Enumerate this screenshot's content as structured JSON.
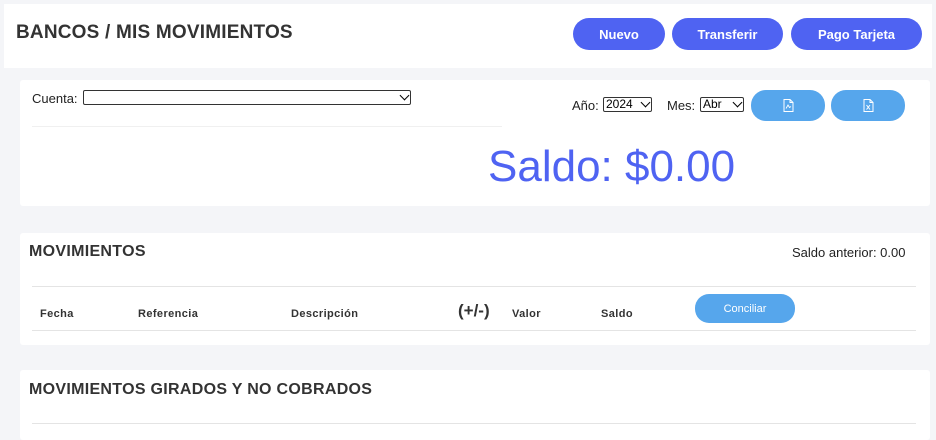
{
  "header": {
    "title": "BANCOS / MIS MOVIMIENTOS",
    "buttons": {
      "nuevo": "Nuevo",
      "transferir": "Transferir",
      "pago_tarjeta": "Pago Tarjeta"
    }
  },
  "filters": {
    "cuenta_label": "Cuenta:",
    "cuenta_value": "",
    "anio_label": "Año:",
    "anio_value": "2024",
    "mes_label": "Mes:",
    "mes_value": "Abr",
    "pdf_icon": "pdf-file-icon",
    "excel_icon": "excel-file-icon"
  },
  "saldo": {
    "text": "Saldo: $0.00"
  },
  "movimientos": {
    "title": "MOVIMIENTOS",
    "saldo_anterior": "Saldo anterior: 0.00",
    "columns": {
      "fecha": "Fecha",
      "referencia": "Referencia",
      "descripcion": "Descripción",
      "signo": "(+/-)",
      "valor": "Valor",
      "saldo": "Saldo"
    },
    "conciliar_label": "Conciliar"
  },
  "girados": {
    "title": "MOVIMIENTOS GIRADOS Y NO COBRADOS"
  },
  "colors": {
    "primary": "#4f63f2",
    "secondary": "#56a6ec"
  }
}
